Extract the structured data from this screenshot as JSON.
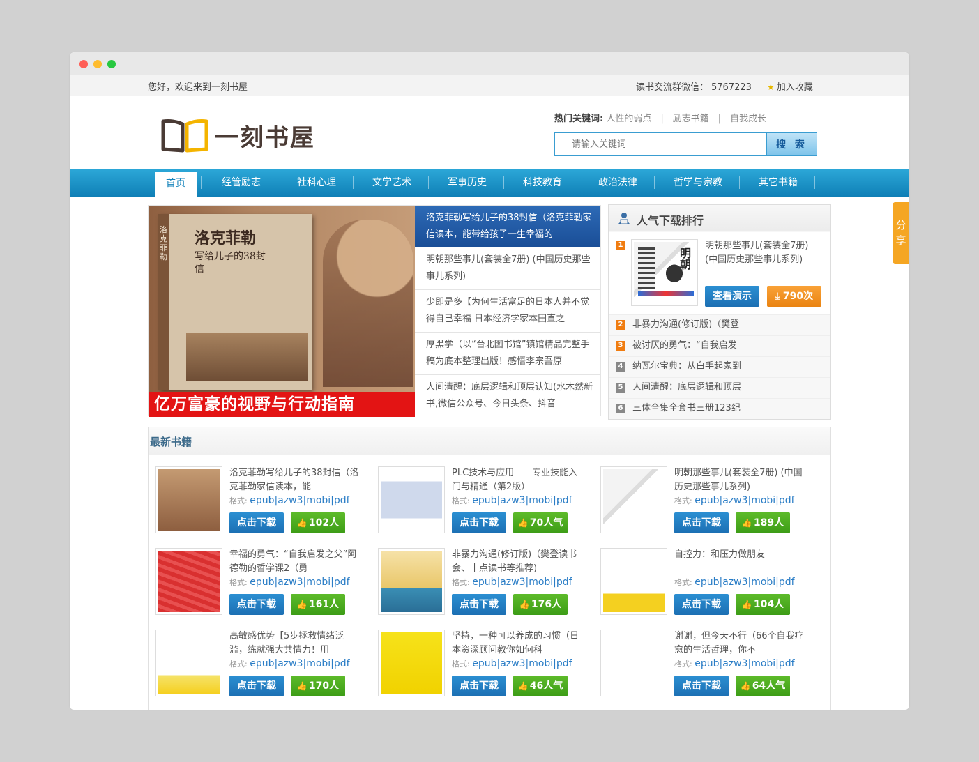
{
  "topbar": {
    "welcome": "您好，欢迎来到一刻书屋",
    "wechat_label": "读书交流群微信：",
    "wechat_value": "5767223",
    "favorite": "加入收藏"
  },
  "header": {
    "logo_text": "一刻书屋",
    "hot_label": "热门关键词:",
    "hot_keywords": [
      "人性的弱点",
      "励志书籍",
      "自我成长"
    ],
    "search_placeholder": "请输入关键词",
    "search_button": "搜 索"
  },
  "nav": [
    "首页",
    "经管励志",
    "社科心理",
    "文学艺术",
    "军事历史",
    "科技教育",
    "政治法律",
    "哲学与宗教",
    "其它书籍"
  ],
  "share": "分享",
  "slider": {
    "cover_title": "洛克菲勒",
    "cover_subtitle": "写给儿子的38封信",
    "banner": "亿万富豪的视野与行动指南",
    "items": [
      "洛克菲勒写给儿子的38封信（洛克菲勒家信读本，能带给孩子一生幸福的",
      "明朝那些事儿(套装全7册) (中国历史那些事儿系列)",
      "少即是多【为何生活富足的日本人并不觉得自己幸福 日本经济学家本田直之",
      "厚黑学（以“台北图书馆”镇馆精品完整手稿为底本整理出版！感悟李宗吾原",
      "人间清醒：底层逻辑和顶层认知(水木然新书,微信公众号、今日头条、抖音"
    ]
  },
  "ranking": {
    "title": "人气下载排行",
    "top": {
      "rank": "1",
      "name": "明朝那些事儿(套装全7册) (中国历史那些事儿系列)",
      "demo": "查看演示",
      "count": "790次"
    },
    "rows": [
      {
        "rank": "2",
        "title": "非暴力沟通(修订版)（樊登"
      },
      {
        "rank": "3",
        "title": "被讨厌的勇气：“自我启发"
      },
      {
        "rank": "4",
        "title": "纳瓦尔宝典：从白手起家到"
      },
      {
        "rank": "5",
        "title": "人间清醒：底层逻辑和顶层"
      },
      {
        "rank": "6",
        "title": "三体全集全套书三册123纪"
      }
    ]
  },
  "newest": {
    "title": "最新书籍",
    "format_label": "格式:",
    "format_value": "epub|azw3|mobi|pdf",
    "download_label": "点击下载",
    "books": [
      {
        "title": "洛克菲勒写给儿子的38封信（洛克菲勒家信读本，能",
        "likes": "102人"
      },
      {
        "title": "PLC技术与应用——专业技能入门与精通（第2版）",
        "likes": "70人气"
      },
      {
        "title": "明朝那些事儿(套装全7册) (中国历史那些事儿系列)",
        "likes": "189人"
      },
      {
        "title": "幸福的勇气：“自我启发之父”阿德勒的哲学课2（勇",
        "likes": "161人"
      },
      {
        "title": "非暴力沟通(修订版)（樊登读书会、十点读书等推荐)",
        "likes": "176人"
      },
      {
        "title": "自控力：和压力做朋友",
        "likes": "104人"
      },
      {
        "title": "高敏感优势【5步拯救情绪泛滥，练就强大共情力！用",
        "likes": "170人"
      },
      {
        "title": "坚持，一种可以养成的习惯（日本资深顾问教你如何科",
        "likes": "46人气"
      },
      {
        "title": "谢谢，但今天不行（66个自我疗愈的生活哲理，你不",
        "likes": "64人气"
      }
    ]
  },
  "colors": {
    "nav_blue": "#1583bb",
    "accent_orange": "#f07c10",
    "download_blue": "#1c6fb3",
    "like_green": "#3c9c16",
    "banner_red": "#e31414"
  }
}
